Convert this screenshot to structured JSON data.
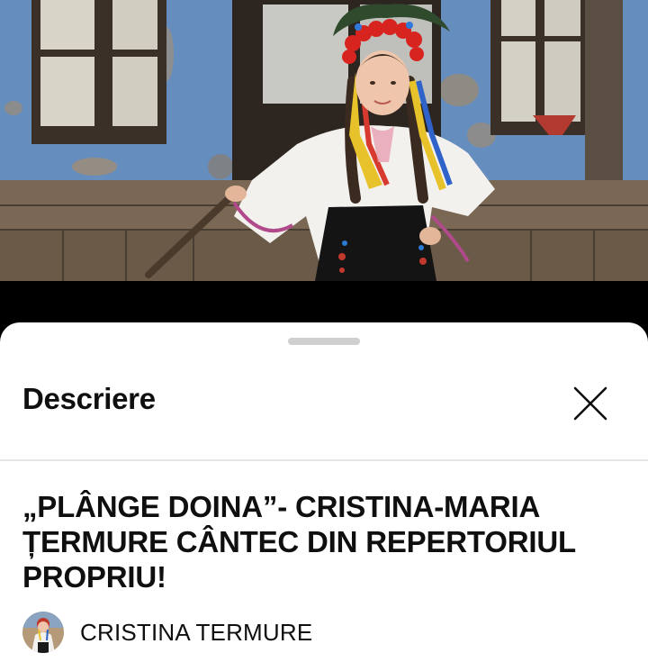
{
  "sheet": {
    "title": "Descriere"
  },
  "video": {
    "title": "„PLÂNGE DOINA”- CRISTINA-MARIA ȚERMURE CÂNTEC DIN REPERTORIUL PROPRIU!",
    "channel_name": "CRISTINA TERMURE"
  },
  "icons": {
    "close": "close-icon",
    "avatar": "channel-avatar"
  },
  "colors": {
    "sheet_background": "#ffffff",
    "text": "#0f0f0f",
    "handle": "#cfcfcf",
    "divider": "#e6e6e6"
  }
}
